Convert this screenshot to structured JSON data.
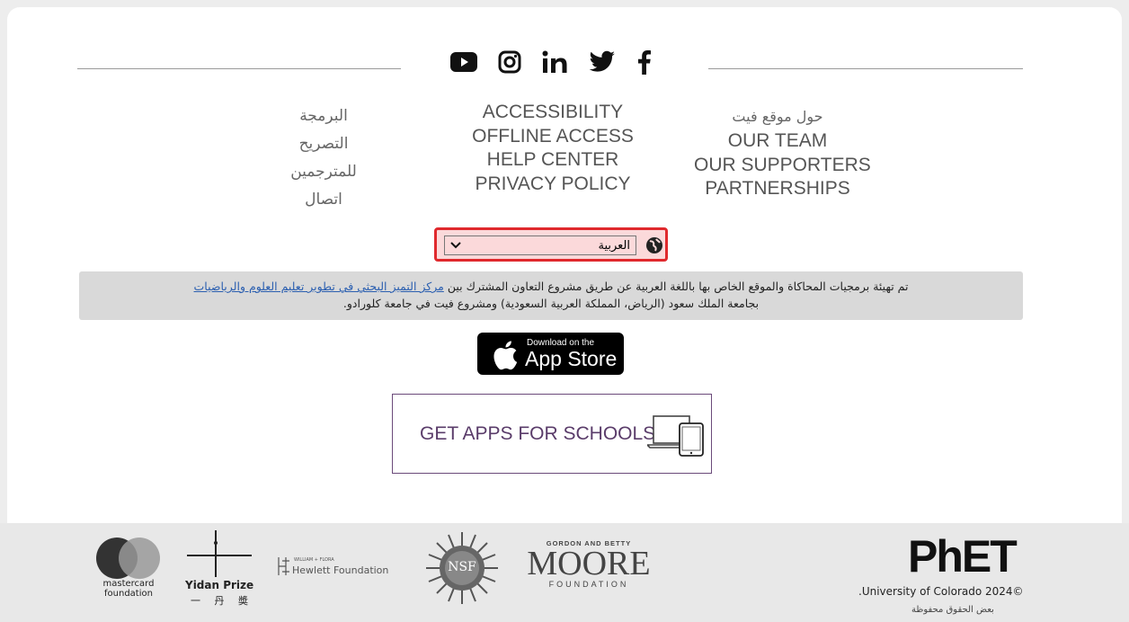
{
  "social": {
    "icons": [
      "youtube-icon",
      "instagram-icon",
      "linkedin-icon",
      "twitter-icon",
      "facebook-icon"
    ]
  },
  "links": {
    "col_right": [
      "حول موقع فيت",
      "OUR TEAM",
      "OUR SUPPORTERS",
      "PARTNERSHIPS"
    ],
    "col_mid": [
      "ACCESSIBILITY",
      "OFFLINE ACCESS",
      "HELP CENTER",
      "PRIVACY POLICY"
    ],
    "col_left": [
      "البرمجة",
      "التصريح",
      "للمترجمين",
      "اتصال"
    ]
  },
  "language": {
    "selected": "العربية"
  },
  "notice": {
    "part1": "تم تهيئة برمجيات المحاكاة والموقع الخاص بها باللغة العربية عن طريق مشروع التعاون المشترك بين",
    "link": "مركز التميز البحثي في تطوير تعليم العلوم والرياضيات",
    "line2": "بجامعة الملك سعود (الرياض، المملكة العربية السعودية) ومشروع فيت في جامعة كلورادو."
  },
  "appstore": {
    "small": "Download on the",
    "big": "App Store"
  },
  "schools": {
    "label": "GET APPS FOR SCHOOLS"
  },
  "footer": {
    "mastercard": "mastercard foundation",
    "yidan": "Yidan Prize",
    "yidan_cn": "一 丹 奬",
    "hewlett_small": "WILLIAM + FLORA",
    "hewlett": "Hewlett Foundation",
    "nsf": "NSF",
    "moore_top": "GORDON AND BETTY",
    "moore": "MOORE",
    "moore_bottom": "FOUNDATION",
    "phet": "PhET",
    "copyright": ".University of Colorado 2024©",
    "rights": "بعض الحقوق محفوظة"
  },
  "colors": {
    "accent_red": "#e0292d",
    "purple": "#5a3c6a",
    "link": "#2b5fb0"
  }
}
